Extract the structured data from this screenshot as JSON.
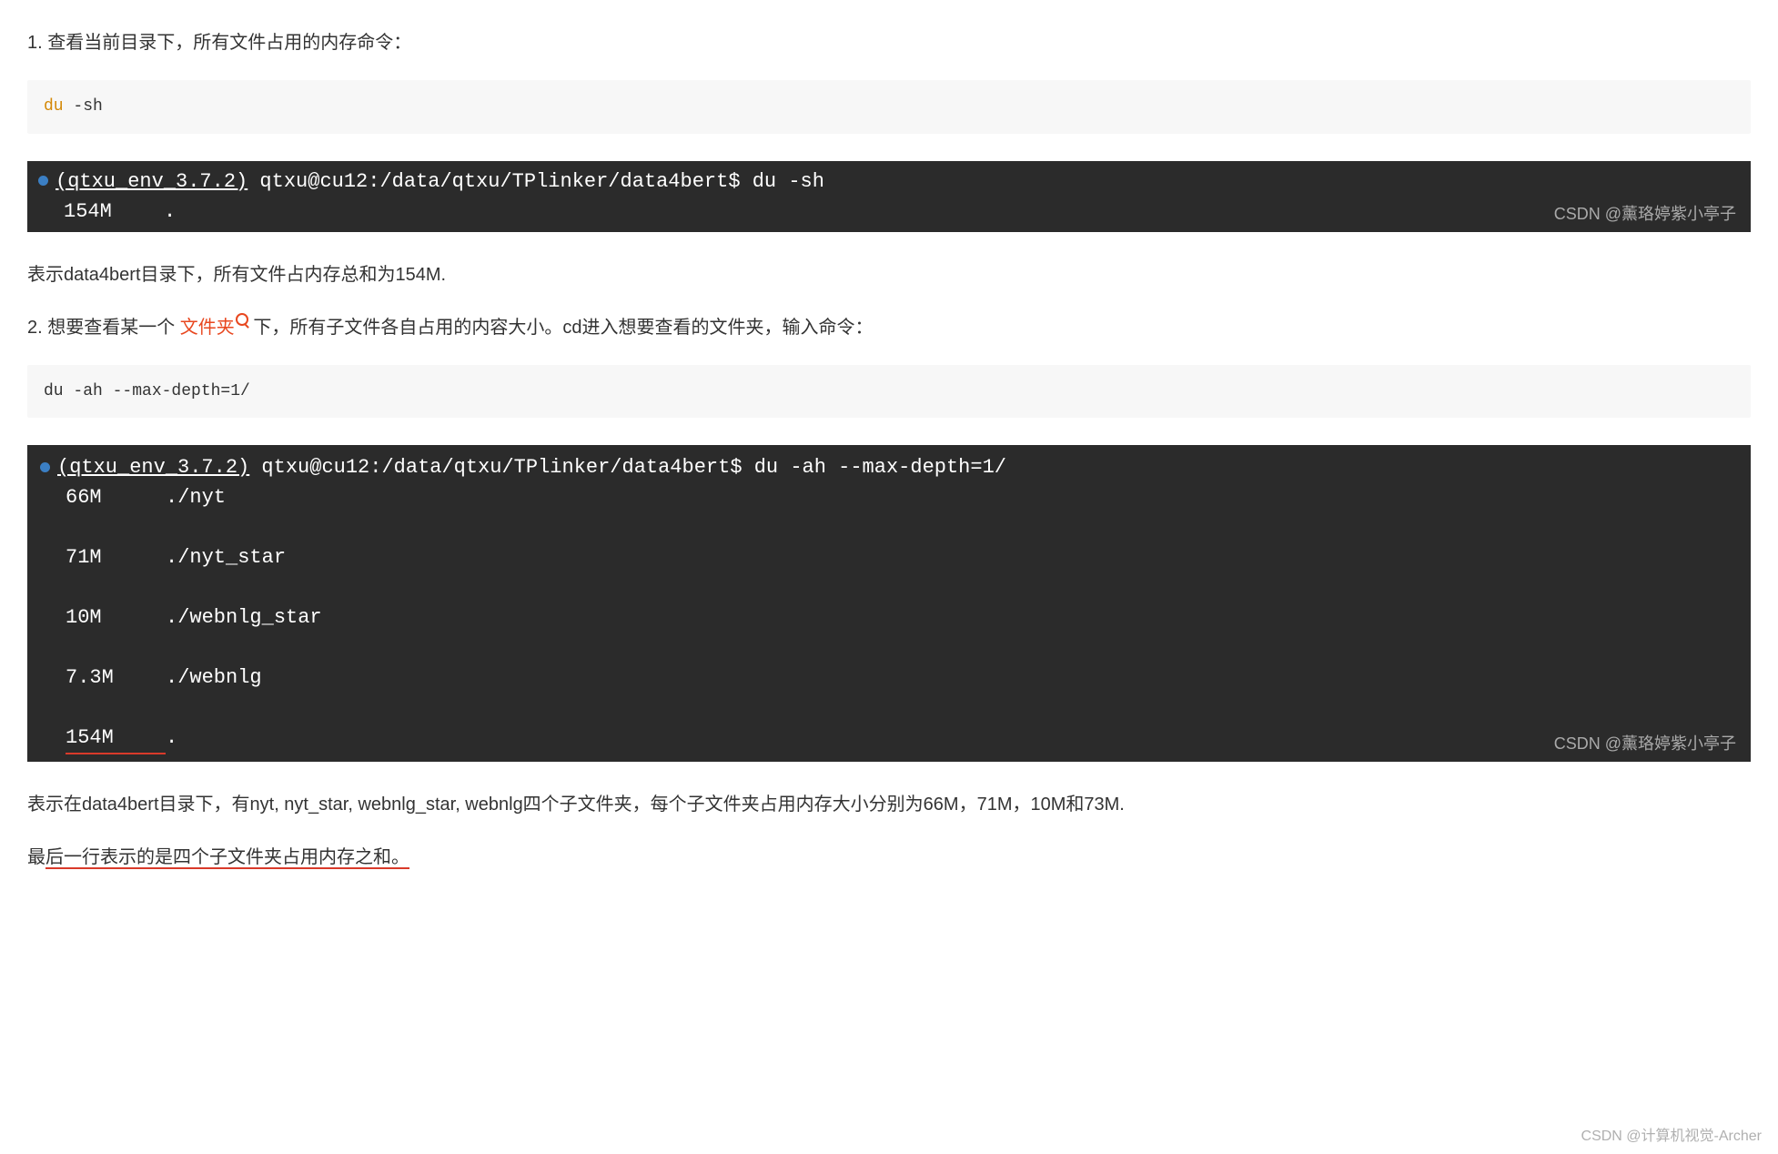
{
  "section1": {
    "heading": "1. 查看当前目录下，所有文件占用的内存命令：",
    "code_kw": "du",
    "code_rest": " -sh",
    "terminal": {
      "env": "(qtxu_env_3.7.2)",
      "prompt": " qtxu@cu12:/data/qtxu/TPlinker/data4bert$ ",
      "cmd": "du -sh",
      "out_size": "154M",
      "out_path": ".",
      "watermark": "CSDN @薰珞婷紫小亭子"
    },
    "explain": "表示data4bert目录下，所有文件占内存总和为154M."
  },
  "section2": {
    "heading_pre": "2. 想要查看某一个 ",
    "heading_link": "文件夹",
    "heading_post": " 下，所有子文件各自占用的内容大小。cd进入想要查看的文件夹，输入命令：",
    "code": "du -ah --max-depth=1/",
    "terminal": {
      "env": "(qtxu_env_3.7.2)",
      "prompt": " qtxu@cu12:/data/qtxu/TPlinker/data4bert$ ",
      "cmd": "du -ah --max-depth=1/",
      "rows": [
        {
          "size": "66M",
          "path": "./nyt"
        },
        {
          "size": "71M",
          "path": "./nyt_star"
        },
        {
          "size": "10M",
          "path": "./webnlg_star"
        },
        {
          "size": "7.3M",
          "path": "./webnlg"
        },
        {
          "size": "154M",
          "path": "."
        }
      ],
      "watermark": "CSDN @薰珞婷紫小亭子"
    },
    "explain": "表示在data4bert目录下，有nyt, nyt_star, webnlg_star, webnlg四个子文件夹，每个子文件夹占用内存大小分别为66M，71M，10M和73M.",
    "final_pre": "最",
    "final_underlined": "后一行表示的是四个子文件夹占用内存之和。"
  },
  "page_watermark": "CSDN @计算机视觉-Archer"
}
